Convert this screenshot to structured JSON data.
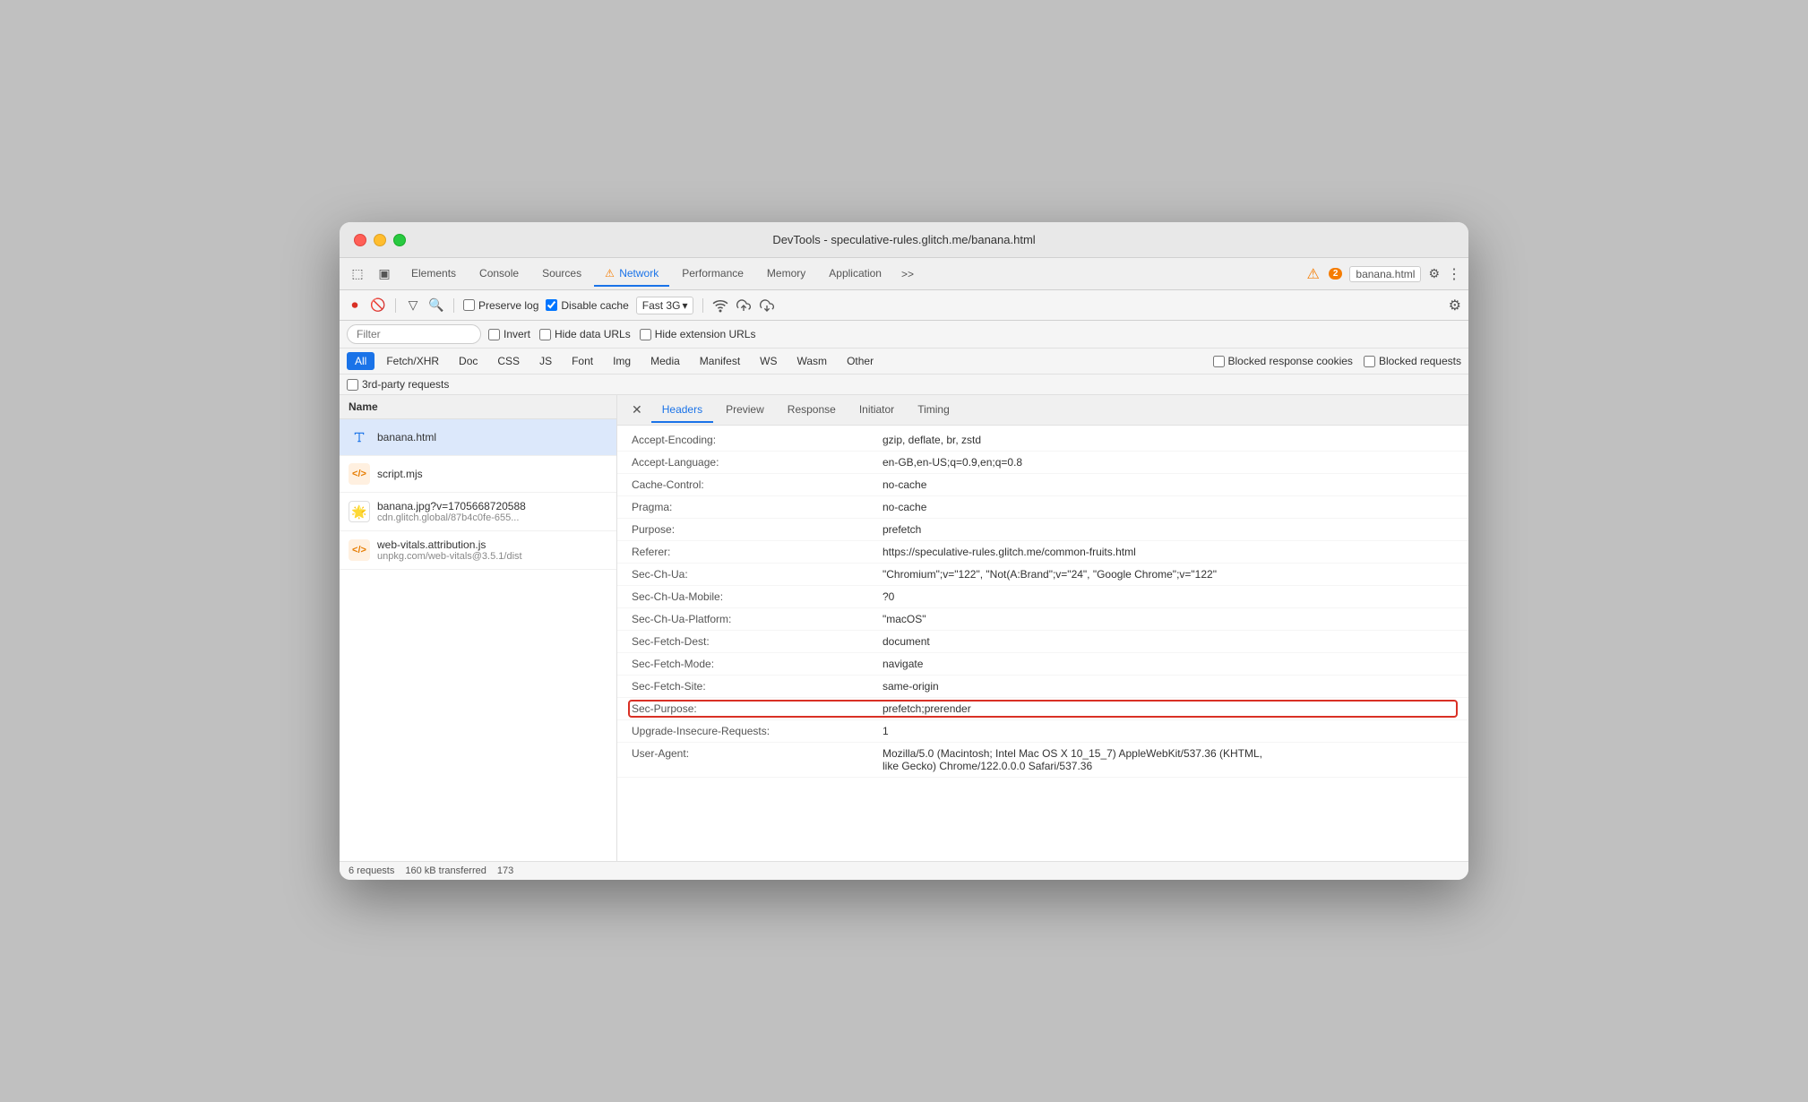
{
  "window": {
    "title": "DevTools - speculative-rules.glitch.me/banana.html"
  },
  "devtools_tabs": {
    "icons": [
      "cursor-icon",
      "device-icon"
    ],
    "tabs": [
      "Elements",
      "Console",
      "Sources",
      "Network",
      "Performance",
      "Memory",
      "Application"
    ],
    "active": "Network",
    "overflow": ">>",
    "warning_label": "⚠",
    "warning_count": "2",
    "page_selector": "banana.html",
    "settings_icon": "⚙",
    "more_icon": "⋮"
  },
  "network_toolbar": {
    "stop_icon": "⏺",
    "clear_icon": "🚫",
    "filter_icon": "🔽",
    "search_icon": "🔍",
    "preserve_log": false,
    "preserve_log_label": "Preserve log",
    "disable_cache": true,
    "disable_cache_label": "Disable cache",
    "throttle": "Fast 3G",
    "throttle_arrow": "▾",
    "wifi_icon": "wifi",
    "upload_icon": "upload",
    "download_icon": "download",
    "settings_icon": "⚙"
  },
  "filter_bar": {
    "placeholder": "Filter",
    "invert_label": "Invert",
    "hide_data_urls_label": "Hide data URLs",
    "hide_ext_urls_label": "Hide extension URLs"
  },
  "type_filters": {
    "buttons": [
      "All",
      "Fetch/XHR",
      "Doc",
      "CSS",
      "JS",
      "Font",
      "Img",
      "Media",
      "Manifest",
      "WS",
      "Wasm",
      "Other"
    ],
    "active": "All",
    "blocked_response_cookies_label": "Blocked response cookies",
    "blocked_requests_label": "Blocked requests"
  },
  "third_party": {
    "label": "3rd-party requests"
  },
  "file_list": {
    "header": "Name",
    "files": [
      {
        "name": "banana.html",
        "url": "",
        "type": "html",
        "icon": "📄",
        "selected": true
      },
      {
        "name": "script.mjs",
        "url": "",
        "type": "js",
        "icon": "⟨⟩",
        "selected": false
      },
      {
        "name": "banana.jpg?v=1705668720588",
        "url": "cdn.glitch.global/87b4c0fe-655...",
        "type": "img",
        "icon": "🌟",
        "selected": false
      },
      {
        "name": "web-vitals.attribution.js",
        "url": "unpkg.com/web-vitals@3.5.1/dist",
        "type": "js",
        "icon": "⟨⟩",
        "selected": false
      }
    ]
  },
  "detail_panel": {
    "tabs": [
      "Headers",
      "Preview",
      "Response",
      "Initiator",
      "Timing"
    ],
    "active_tab": "Headers",
    "headers": [
      {
        "name": "Accept-Encoding:",
        "value": "gzip, deflate, br, zstd",
        "highlighted": false
      },
      {
        "name": "Accept-Language:",
        "value": "en-GB,en-US;q=0.9,en;q=0.8",
        "highlighted": false
      },
      {
        "name": "Cache-Control:",
        "value": "no-cache",
        "highlighted": false
      },
      {
        "name": "Pragma:",
        "value": "no-cache",
        "highlighted": false
      },
      {
        "name": "Purpose:",
        "value": "prefetch",
        "highlighted": false
      },
      {
        "name": "Referer:",
        "value": "https://speculative-rules.glitch.me/common-fruits.html",
        "highlighted": false
      },
      {
        "name": "Sec-Ch-Ua:",
        "value": "\"Chromium\";v=\"122\", \"Not(A:Brand\";v=\"24\", \"Google Chrome\";v=\"122\"",
        "highlighted": false
      },
      {
        "name": "Sec-Ch-Ua-Mobile:",
        "value": "?0",
        "highlighted": false
      },
      {
        "name": "Sec-Ch-Ua-Platform:",
        "value": "\"macOS\"",
        "highlighted": false
      },
      {
        "name": "Sec-Fetch-Dest:",
        "value": "document",
        "highlighted": false
      },
      {
        "name": "Sec-Fetch-Mode:",
        "value": "navigate",
        "highlighted": false
      },
      {
        "name": "Sec-Fetch-Site:",
        "value": "same-origin",
        "highlighted": false
      },
      {
        "name": "Sec-Purpose:",
        "value": "prefetch;prerender",
        "highlighted": true
      },
      {
        "name": "Upgrade-Insecure-Requests:",
        "value": "1",
        "highlighted": false
      },
      {
        "name": "User-Agent:",
        "value": "Mozilla/5.0 (Macintosh; Intel Mac OS X 10_15_7) AppleWebKit/537.36 (KHTML, like Gecko) Chrome/122.0.0.0 Safari/537.36",
        "highlighted": false
      }
    ]
  },
  "status_bar": {
    "requests": "6 requests",
    "transferred": "160 kB transferred",
    "size": "173"
  }
}
